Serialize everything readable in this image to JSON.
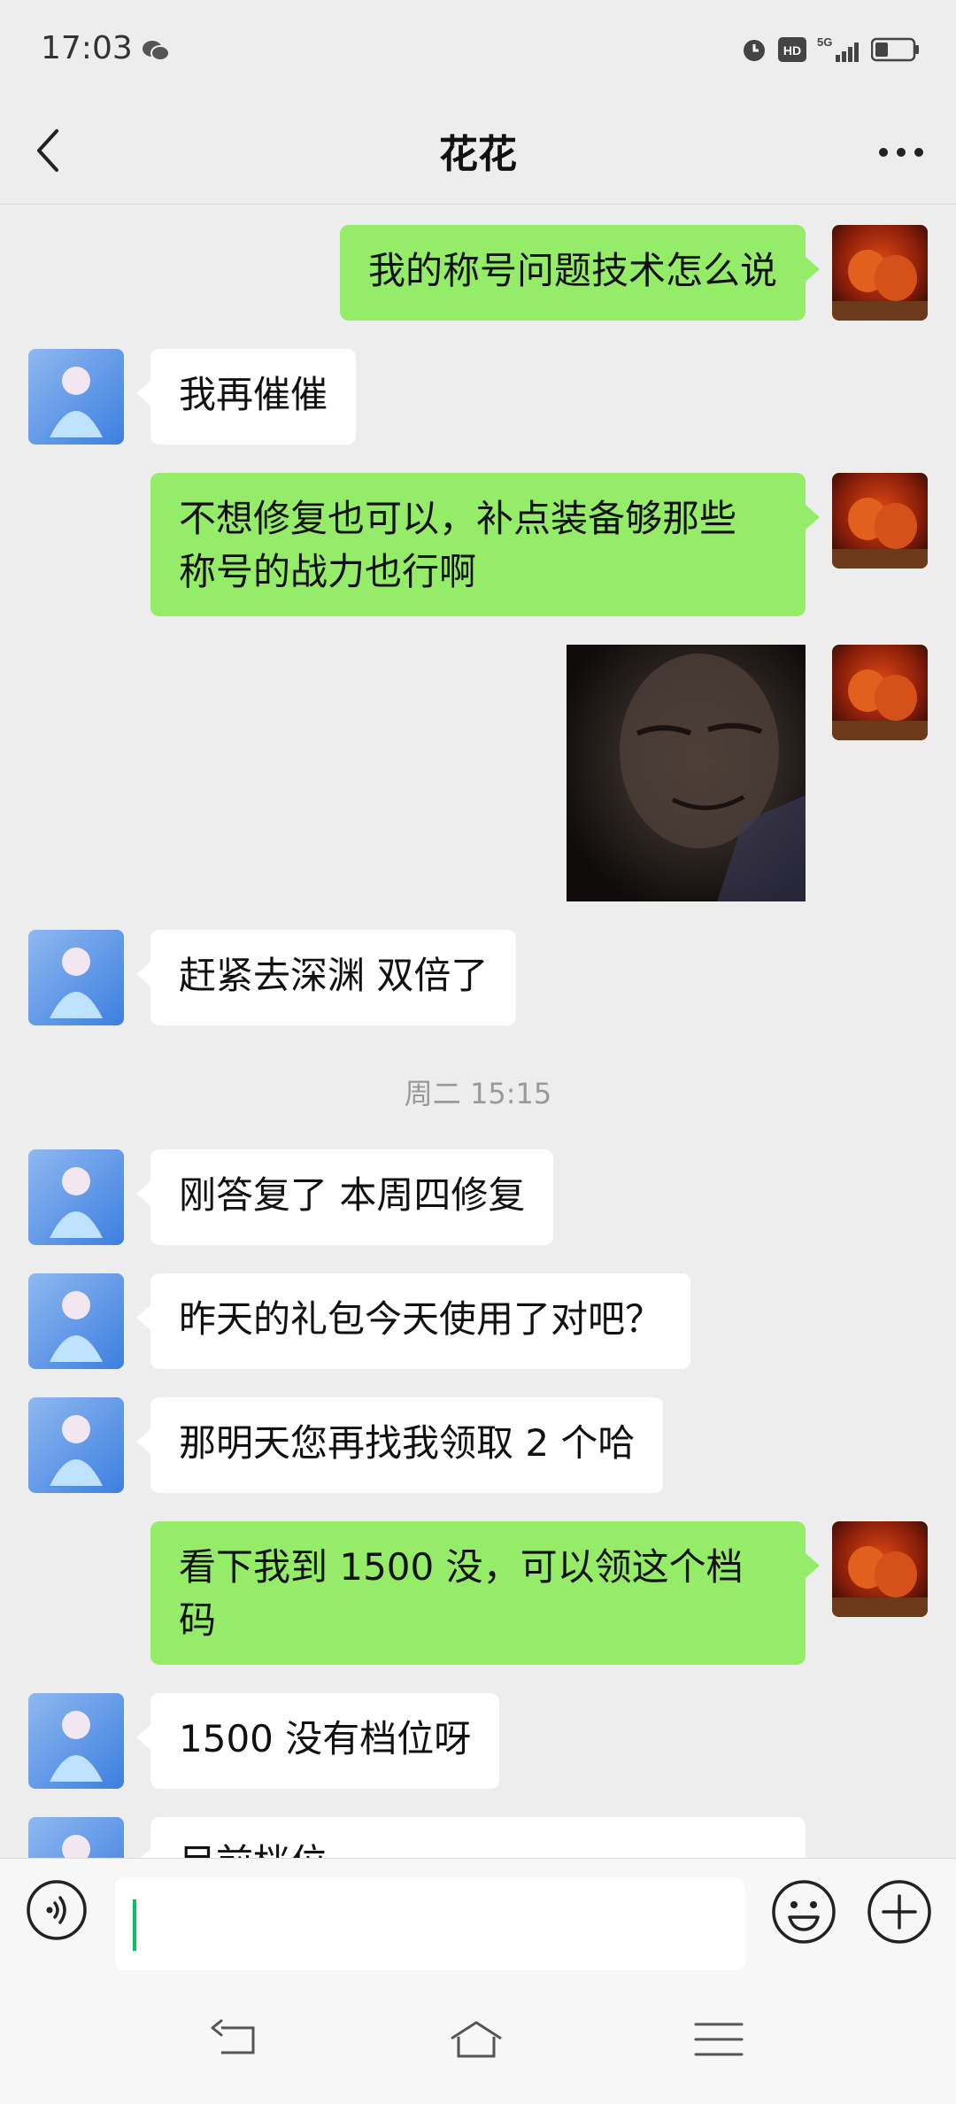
{
  "status_bar": {
    "time": "17:03",
    "icons": [
      "wechat-icon",
      "alarm-icon",
      "hd-icon",
      "5g-signal-icon",
      "battery-icon"
    ],
    "hd_label": "HD",
    "network_label": "5G"
  },
  "header": {
    "title": "花花",
    "back_icon": "chevron-left-icon",
    "more_icon": "more-dots-icon"
  },
  "messages": [
    {
      "side": "right",
      "type": "text",
      "text": "我的称号问题技术怎么说"
    },
    {
      "side": "left",
      "type": "text",
      "text": "我再催催"
    },
    {
      "side": "right",
      "type": "text",
      "lines": [
        "不想修复也可以，补点装备够那些",
        "称号的战力也行啊"
      ]
    },
    {
      "side": "right",
      "type": "image"
    },
    {
      "side": "left",
      "type": "text",
      "text": "赶紧去深渊 双倍了"
    },
    {
      "type": "timestamp",
      "text": "周二 15:15"
    },
    {
      "side": "left",
      "type": "text",
      "text": "刚答复了  本周四修复"
    },
    {
      "side": "left",
      "type": "text",
      "text": "昨天的礼包今天使用了对吧？"
    },
    {
      "side": "left",
      "type": "text",
      "text": "那明天您再找我领取 2 个哈"
    },
    {
      "side": "right",
      "type": "text",
      "lines": [
        "看下我到 1500 没，可以领这个档",
        "码"
      ]
    },
    {
      "side": "left",
      "type": "text",
      "text": "1500 没有档位呀"
    },
    {
      "side": "left",
      "type": "text",
      "text": "目前档位"
    }
  ],
  "input_bar": {
    "voice_icon": "voice-icon",
    "emoji_icon": "emoji-icon",
    "plus_icon": "plus-icon"
  },
  "system_nav": {
    "icons": [
      "back-key-icon",
      "home-key-icon",
      "menu-key-icon"
    ]
  },
  "colors": {
    "background": "#ededed",
    "self_bubble": "#95ec69",
    "other_bubble": "#ffffff",
    "caret": "#07c160"
  }
}
